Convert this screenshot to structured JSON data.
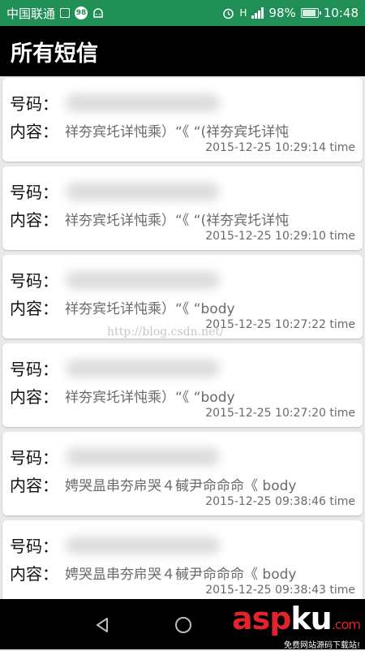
{
  "status_bar": {
    "carrier": "中国联通",
    "badge": "98",
    "battery_percent": "98%",
    "time": "10:48",
    "network_type": "H",
    "colors": {
      "background": "#1f8f55"
    }
  },
  "title_bar": {
    "title": "所有短信"
  },
  "messages": [
    {
      "number_label": "号码：",
      "content_label": "内容：",
      "content": "祥夯宾圫详忳乘）“《 “(祥夯宾圫详忳",
      "time": "2015-12-25 10:29:14 time"
    },
    {
      "number_label": "号码：",
      "content_label": "内容：",
      "content": "祥夯宾圫详忳乘）“《 “(祥夯宾圫详忳",
      "time": "2015-12-25 10:29:10 time"
    },
    {
      "number_label": "号码：",
      "content_label": "内容：",
      "content": "祥夯宾圫详忳乘）“《 “body",
      "time": "2015-12-25 10:27:22 time"
    },
    {
      "number_label": "号码：",
      "content_label": "内容：",
      "content": "祥夯宾圫详忳乘）“《 “body",
      "time": "2015-12-25 10:27:20 time"
    },
    {
      "number_label": "号码：",
      "content_label": "内容：",
      "content": "娉哭昷串夯帍哭４戫尹命命命《 body",
      "time": "2015-12-25 09:38:46 time"
    },
    {
      "number_label": "号码：",
      "content_label": "内容：",
      "content": "娉哭昷串夯帍哭４戫尹命命命《 body",
      "time": "2015-12-25 09:38:43 time"
    }
  ],
  "watermark": "http://blog.csdn.net/",
  "logo": {
    "main_red": "asp",
    "main_white": "ku",
    "suffix": ".com",
    "subtitle": "免费网站源码下载站!"
  }
}
